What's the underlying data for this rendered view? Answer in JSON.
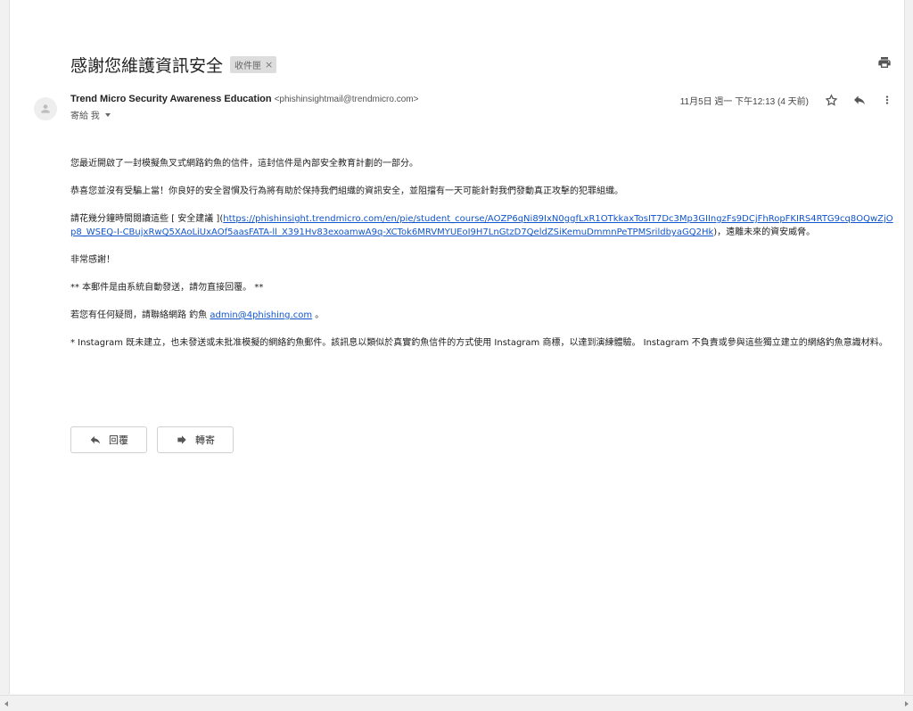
{
  "email": {
    "subject": "感謝您維護資訊安全",
    "label": "收件匣",
    "label_close": "×",
    "sender_name": "Trend Micro Security Awareness Education",
    "sender_email": "<phishinsightmail@trendmicro.com>",
    "to_line": "寄給 我",
    "date": "11月5日 週一 下午12:13 (4 天前)",
    "body": {
      "p1": "您最近開啟了一封模擬魚叉式網路釣魚的信件，這封信件是內部安全教育計劃的一部分。",
      "p2": "恭喜您並沒有受騙上當！你良好的安全習慣及行為將有助於保持我們組織的資訊安全，並阻擋有一天可能針對我們發動真正攻擊的犯罪組織。",
      "p3_prefix": "請花幾分鐘時間閱讀這些 [ 安全建議 ](",
      "p3_link": "https://phishinsight.trendmicro.com/en/pie/student_course/AOZP6qNi89IxN0ggfLxR1OTkkaxTosIT7Dc3Mp3GIIngzFs9DCjFhRopFKIRS4RTG9cq8OQwZjOp8_WSEQ-I-CBujxRwQ5XAoLiUxAOf5aasFATA-ll_X391Hv83exoamwA9q-XCTok6MRVMYUEoI9H7LnGtzD7QeldZSiKemuDmmnPeTPMSrildbyaGQ2Hk",
      "p3_suffix": ")，遠離未來的資安威脅。",
      "p4": "非常感謝！",
      "p5": "** 本郵件是由系統自動發送，請勿直接回覆。 **",
      "p6_prefix": "若您有任何疑問，請聯絡網路 釣魚 ",
      "p6_link": "admin@4phishing.com",
      "p6_suffix": " 。",
      "p7": "* Instagram 既未建立，也未發送或未批准模擬的網絡釣魚郵件。該訊息以類似於真實釣魚信件的方式使用 Instagram 商標，以達到演練體驗。 Instagram 不負責或參與這些獨立建立的網絡釣魚意識材料。"
    },
    "reply_label": "回覆",
    "forward_label": "轉寄"
  },
  "icons": {
    "print": "print-icon",
    "star": "star-icon",
    "reply": "reply-icon",
    "more": "more-vert-icon",
    "avatar": "person-icon",
    "forward": "forward-icon"
  }
}
